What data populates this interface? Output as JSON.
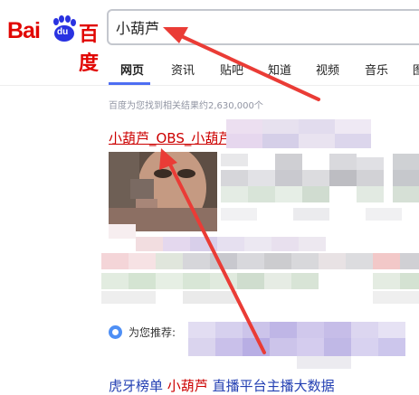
{
  "logo": {
    "bai": "Bai",
    "du": "du",
    "baidu": "百度"
  },
  "search": {
    "value": "小葫芦"
  },
  "tabs": [
    {
      "label": "网页"
    },
    {
      "label": "资讯"
    },
    {
      "label": "贴吧"
    },
    {
      "label": "知道"
    },
    {
      "label": "视频"
    },
    {
      "label": "音乐"
    },
    {
      "label": "图"
    }
  ],
  "stats": "百度为您找到相关结果约2,630,000个",
  "result1": {
    "title": "小葫芦_OBS_小葫芦"
  },
  "recommend": {
    "label": "为您推荐:"
  },
  "result2": {
    "prefix": "虎牙榜单  ",
    "highlight": "小葫芦",
    "suffix": " 直播平台主播大数据"
  },
  "colors": {
    "brand_red": "#e10602",
    "link_red": "#cc0000",
    "link_blue": "#2440b3",
    "tab_accent": "#4e6ef2",
    "arrow_red": "#ea3c36"
  }
}
